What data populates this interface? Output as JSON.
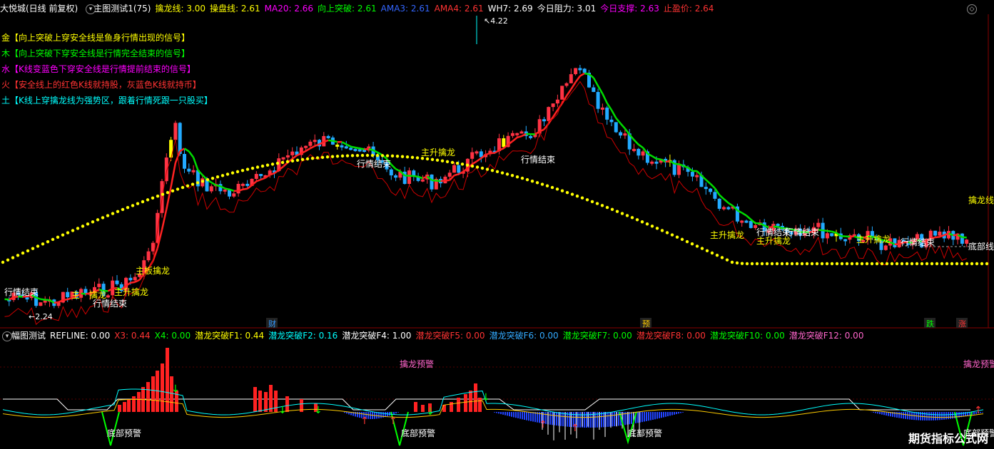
{
  "main_header": {
    "items": [
      {
        "text": "大悦城(日线 前复权)",
        "color": "#ffffff"
      },
      {
        "text": "主图测试1(75)",
        "color": "#ffffff"
      },
      {
        "text": "擒龙线: 3.00",
        "color": "#ffff00"
      },
      {
        "text": "操盘线: 2.61",
        "color": "#ffff00"
      },
      {
        "text": "MA20: 2.66",
        "color": "#ff00ff"
      },
      {
        "text": "向上突破: 2.61",
        "color": "#00ff00"
      },
      {
        "text": "AMA3: 2.61",
        "color": "#3366ff"
      },
      {
        "text": "AMA4: 2.61",
        "color": "#ff3333"
      },
      {
        "text": "WH7: 2.69",
        "color": "#ffffff"
      },
      {
        "text": "今日阻力: 3.01",
        "color": "#ffffff"
      },
      {
        "text": "今日支撑: 2.63",
        "color": "#ff00ff"
      },
      {
        "text": "止盈价: 2.64",
        "color": "#ff3333"
      }
    ]
  },
  "legend": [
    {
      "text": "金【向上突破上穿安全线是鱼身行情出现的信号】",
      "color": "#ffff00"
    },
    {
      "text": "木【向上突破下穿安全线是行情完全结束的信号】",
      "color": "#00ff00"
    },
    {
      "text": "水【K线变蓝色下穿安全线是行情提前结束的信号】",
      "color": "#ff00ff"
    },
    {
      "text": "火【安全线上的红色K线就持股，灰蓝色K线就持币】",
      "color": "#ff3333"
    },
    {
      "text": "土【K线上穿擒龙线为强势区，跟着行情死跟一只股买】",
      "color": "#00ffff"
    }
  ],
  "price_labels": {
    "high": "4.22",
    "low": "2.24"
  },
  "annotations": [
    {
      "text": "行情结束",
      "color": "#ffffff"
    },
    {
      "text": "主",
      "color": "#ffff00"
    },
    {
      "text": "擒龙",
      "color": "#ffff00"
    },
    {
      "text": "主升擒龙",
      "color": "#ffff00"
    },
    {
      "text": "行情结束",
      "color": "#ffffff"
    },
    {
      "text": "主板擒龙",
      "color": "#ffff00"
    },
    {
      "text": "行情结束",
      "color": "#ffffff"
    },
    {
      "text": "主升擒龙",
      "color": "#ffff00"
    },
    {
      "text": "行情结束",
      "color": "#ffffff"
    },
    {
      "text": "主升擒龙",
      "color": "#ffff00"
    },
    {
      "text": "行情结束",
      "color": "#ffffff"
    },
    {
      "text": "主升擒龙",
      "color": "#ffff00"
    },
    {
      "text": "行情结束",
      "color": "#ffffff"
    },
    {
      "text": "主升擒龙",
      "color": "#ffff00"
    },
    {
      "text": "行情结束",
      "color": "#ffffff"
    },
    {
      "text": "擒龙线",
      "color": "#ffff00"
    },
    {
      "text": "底部线",
      "color": "#ffffff"
    }
  ],
  "bottom_markers": [
    {
      "text": "财",
      "color": "#3399ff"
    },
    {
      "text": "预",
      "color": "#ffcc00"
    },
    {
      "text": "跌",
      "color": "#00ff00"
    },
    {
      "text": "涨",
      "color": "#ff3333"
    }
  ],
  "sub_header": {
    "items": [
      {
        "text": "幅图测试",
        "color": "#ffffff"
      },
      {
        "text": "REFLINE: 0.00",
        "color": "#ffffff"
      },
      {
        "text": "X3: 0.44",
        "color": "#ff3333"
      },
      {
        "text": "X4: 0.00",
        "color": "#00ff00"
      },
      {
        "text": "潜龙突破F1: 0.44",
        "color": "#ffff00"
      },
      {
        "text": "潜龙突破F2: 0.16",
        "color": "#00ffff"
      },
      {
        "text": "潜龙突破F4: 1.00",
        "color": "#ffffff"
      },
      {
        "text": "潜龙突破F5: 0.00",
        "color": "#ff3333"
      },
      {
        "text": "潜龙突破F6: 0.00",
        "color": "#33aaff"
      },
      {
        "text": "潜龙突破F7: 0.00",
        "color": "#00ff00"
      },
      {
        "text": "潜龙突破F8: 0.00",
        "color": "#ff3333"
      },
      {
        "text": "潜龙突破F10: 0.00",
        "color": "#00ff00"
      },
      {
        "text": "潜龙突破F12: 0.00",
        "color": "#ff66cc"
      }
    ]
  },
  "sub_annotations": [
    {
      "text": "擒龙预警",
      "color": "#ff66cc"
    },
    {
      "text": "擒龙预警",
      "color": "#ff66cc"
    },
    {
      "text": "底部预警",
      "color": "#ffffff"
    },
    {
      "text": "底部预警",
      "color": "#ffffff"
    },
    {
      "text": "底部预警",
      "color": "#ffffff"
    },
    {
      "text": "底部预警",
      "color": "#ffffff"
    }
  ],
  "watermark": "期货指标公式网",
  "colors": {
    "up": "#ff3344",
    "down": "#22aaff",
    "ma": "#ff2222",
    "ma_green": "#00dd00",
    "dots": "#ffff00",
    "grid": "#880000"
  }
}
